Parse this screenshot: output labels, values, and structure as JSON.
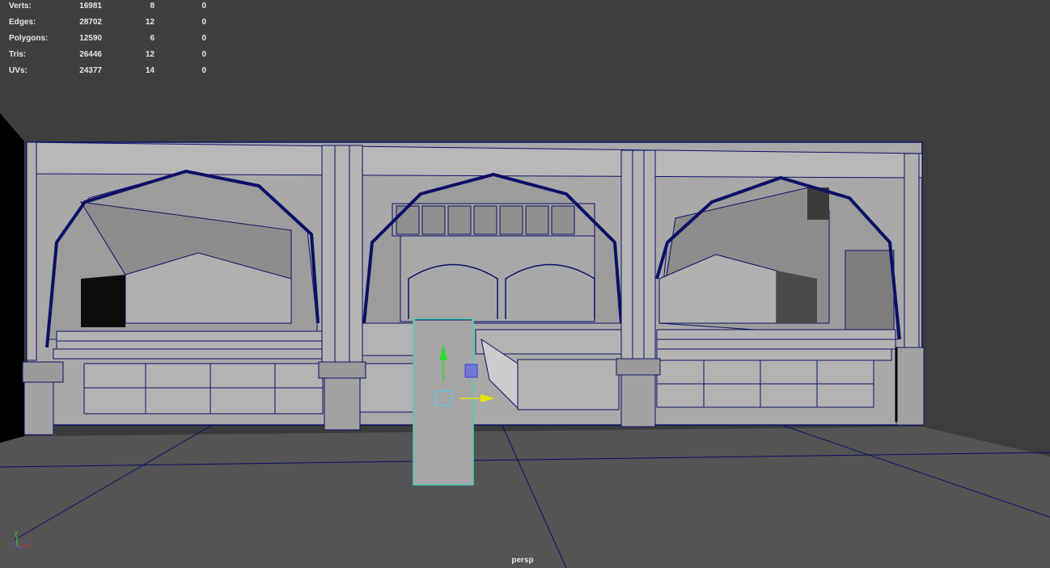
{
  "hud": {
    "rows": [
      {
        "label": "Verts:",
        "total": "16981",
        "selected": "8",
        "highlighted": "0"
      },
      {
        "label": "Edges:",
        "total": "28702",
        "selected": "12",
        "highlighted": "0"
      },
      {
        "label": "Polygons:",
        "total": "12590",
        "selected": "6",
        "highlighted": "0"
      },
      {
        "label": "Tris:",
        "total": "26446",
        "selected": "12",
        "highlighted": "0"
      },
      {
        "label": "UVs:",
        "total": "24377",
        "selected": "14",
        "highlighted": "0"
      }
    ]
  },
  "viewport": {
    "camera": "persp",
    "colors": {
      "background": "#3c3c3c",
      "floor": "#545454",
      "geometry": "#a9a9a9",
      "wireframe": "#0b1066",
      "selection": "#47d3b6",
      "axis_y": "#2fd82f",
      "axis_x": "#e8e400"
    }
  },
  "axis_indicator": {
    "y": "y",
    "x": "x",
    "z": "z"
  },
  "manipulator": {
    "type": "move-tool"
  }
}
